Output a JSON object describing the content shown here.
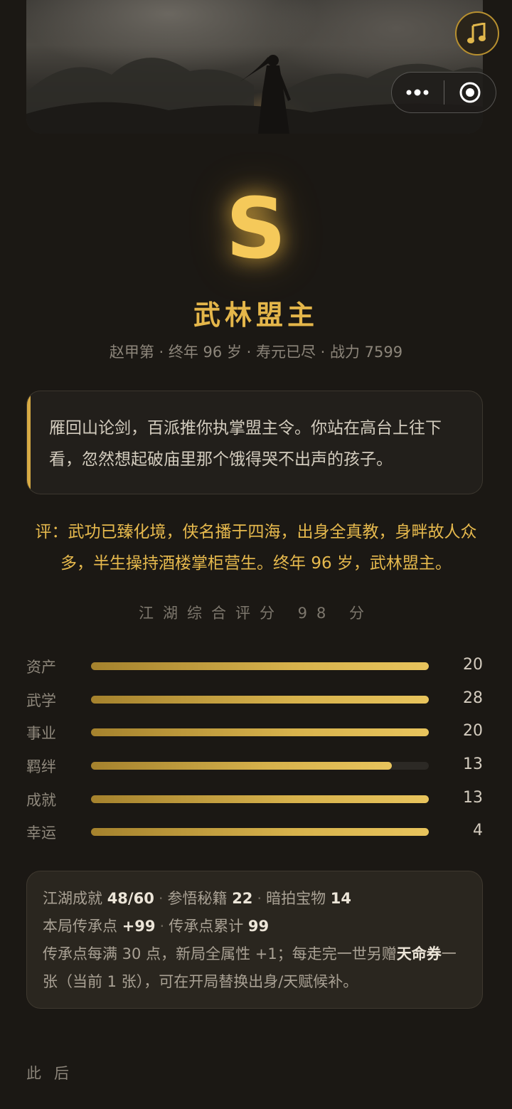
{
  "header": {
    "music_icon": "music-note-icon",
    "more_icon": "more-dots-icon",
    "close_icon": "target-circle-icon"
  },
  "result": {
    "grade": "S",
    "title": "武林盟主",
    "meta": "赵甲第 · 终年 96 岁 · 寿元已尽 · 战力 7599",
    "quote": "雁回山论剑，百派推你执掌盟主令。你站在高台上往下看，忽然想起破庙里那个饿得哭不出声的孩子。",
    "review": "评：武功已臻化境，侠名播于四海，出身全真教，身畔故人众多，半生操持酒楼掌柜营生。终年 96 岁，武林盟主。",
    "score": "江湖综合评分 98 分"
  },
  "attributes": [
    {
      "label": "资产",
      "value": "20",
      "fill": 1.0
    },
    {
      "label": "武学",
      "value": "28",
      "fill": 1.0
    },
    {
      "label": "事业",
      "value": "20",
      "fill": 1.0
    },
    {
      "label": "羁绊",
      "value": "13",
      "fill": 0.89
    },
    {
      "label": "成就",
      "value": "13",
      "fill": 1.0
    },
    {
      "label": "幸运",
      "value": "4",
      "fill": 1.0
    }
  ],
  "stats": {
    "achievement_label": "江湖成就",
    "achievement_value": "48/60",
    "secret_label": "参悟秘籍",
    "secret_value": "22",
    "treasure_label": "暗拍宝物",
    "treasure_value": "14",
    "legacy_label": "本局传承点",
    "legacy_value": "+99",
    "legacy_total_label": "传承点累计",
    "legacy_total_value": "99",
    "note_prefix": "传承点每满 30 点，新局全属性 +1；每走完一世另赠",
    "note_highlight": "天命券",
    "note_suffix": "一张（当前 1 张），可在开局替换出身/天赋候补。"
  },
  "footer": {
    "after_label": "此后"
  },
  "colors": {
    "background": "#1b1814",
    "accent_gold": "#e4b64a",
    "grade_gold": "#f5c95a"
  }
}
